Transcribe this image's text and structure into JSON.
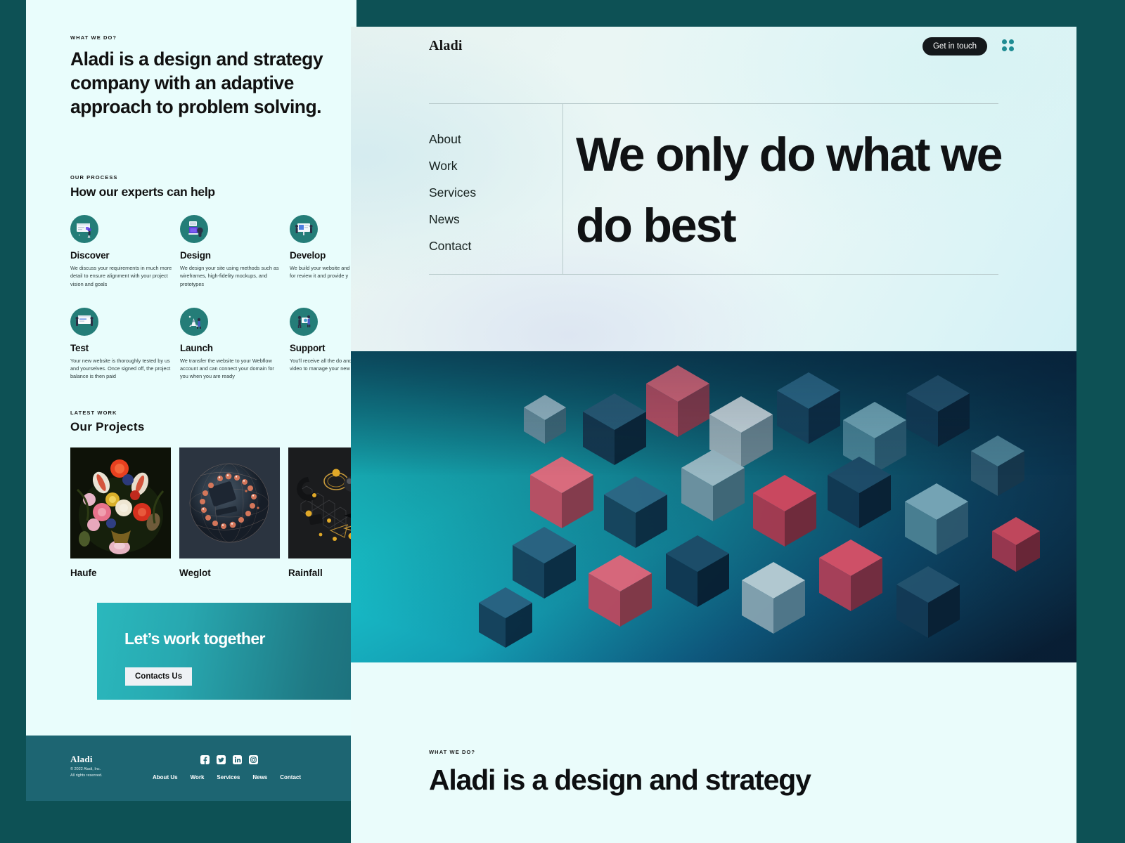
{
  "colors": {
    "page_bg": "#0d5155",
    "card_bg": "#e9fdfc",
    "panel_bg": "#eefcfb",
    "accent_teal": "#247d78",
    "footer_teal": "#1d6572",
    "cta_gradient_start": "#2ab8bd",
    "cta_gradient_end": "#1b6c78",
    "dot_teal": "#1f8c93",
    "dark": "#14181b"
  },
  "left_card": {
    "hero": {
      "eyebrow": "WHAT WE DO?",
      "title": "Aladi is a design and strategy company with an adaptive approach to problem solving."
    },
    "process": {
      "eyebrow": "OUR PROCESS",
      "title": "How our experts can help",
      "items": [
        {
          "icon": "discover-icon",
          "name": "Discover",
          "desc": "We discuss your requirements in much more detail to ensure alignment with  your project vision and goals"
        },
        {
          "icon": "design-icon",
          "name": "Design",
          "desc": "We design your site using methods such as wireframes, high-fidelity mockups, and prototypes"
        },
        {
          "icon": "develop-icon",
          "name": "Develop",
          "desc": "We build your website and then share a link for review it and provide y"
        },
        {
          "icon": "test-icon",
          "name": "Test",
          "desc": "Your new website is thoroughly tested by us and yourselves. Once signed off, the project balance is then paid"
        },
        {
          "icon": "launch-icon",
          "name": "Launch",
          "desc": "We transfer the website to your Webflow account and can connect your domain for you when you are ready"
        },
        {
          "icon": "support-icon",
          "name": "Support",
          "desc": "You'll receive all the do and walkthrough video to manage your new w"
        }
      ]
    },
    "projects": {
      "eyebrow": "LATEST WORK",
      "title": "Our  Projects",
      "items": [
        {
          "name": "Haufe",
          "thumb": "floral-still-life-thumbnail"
        },
        {
          "name": "Weglot",
          "thumb": "dark-sphere-render-thumbnail"
        },
        {
          "name": "Rainfall",
          "thumb": "gold-star-render-thumbnail"
        }
      ]
    },
    "cta": {
      "title": "Let’s work together",
      "button_label": "Contacts Us"
    },
    "footer": {
      "logo": "Aladi",
      "copyright_line1": "© 2022 Aladi, Inc.",
      "copyright_line2": "All rights reserved.",
      "social": [
        "facebook-icon",
        "twitter-icon",
        "linkedin-icon",
        "instagram-icon"
      ],
      "nav": [
        "About Us",
        "Work",
        "Services",
        "News",
        "Contact"
      ]
    }
  },
  "right_panel": {
    "logo": "Aladi",
    "get_in_touch_label": "Get in touch",
    "menu_icon": "grid-dots-menu-icon",
    "nav": [
      "About",
      "Work",
      "Services",
      "News",
      "Contact"
    ],
    "heading": "We only do what we do best",
    "visual": "isometric-3d-cubes-render",
    "bottom": {
      "eyebrow": "WHAT WE DO?",
      "title": "Aladi is a design and strategy"
    }
  }
}
